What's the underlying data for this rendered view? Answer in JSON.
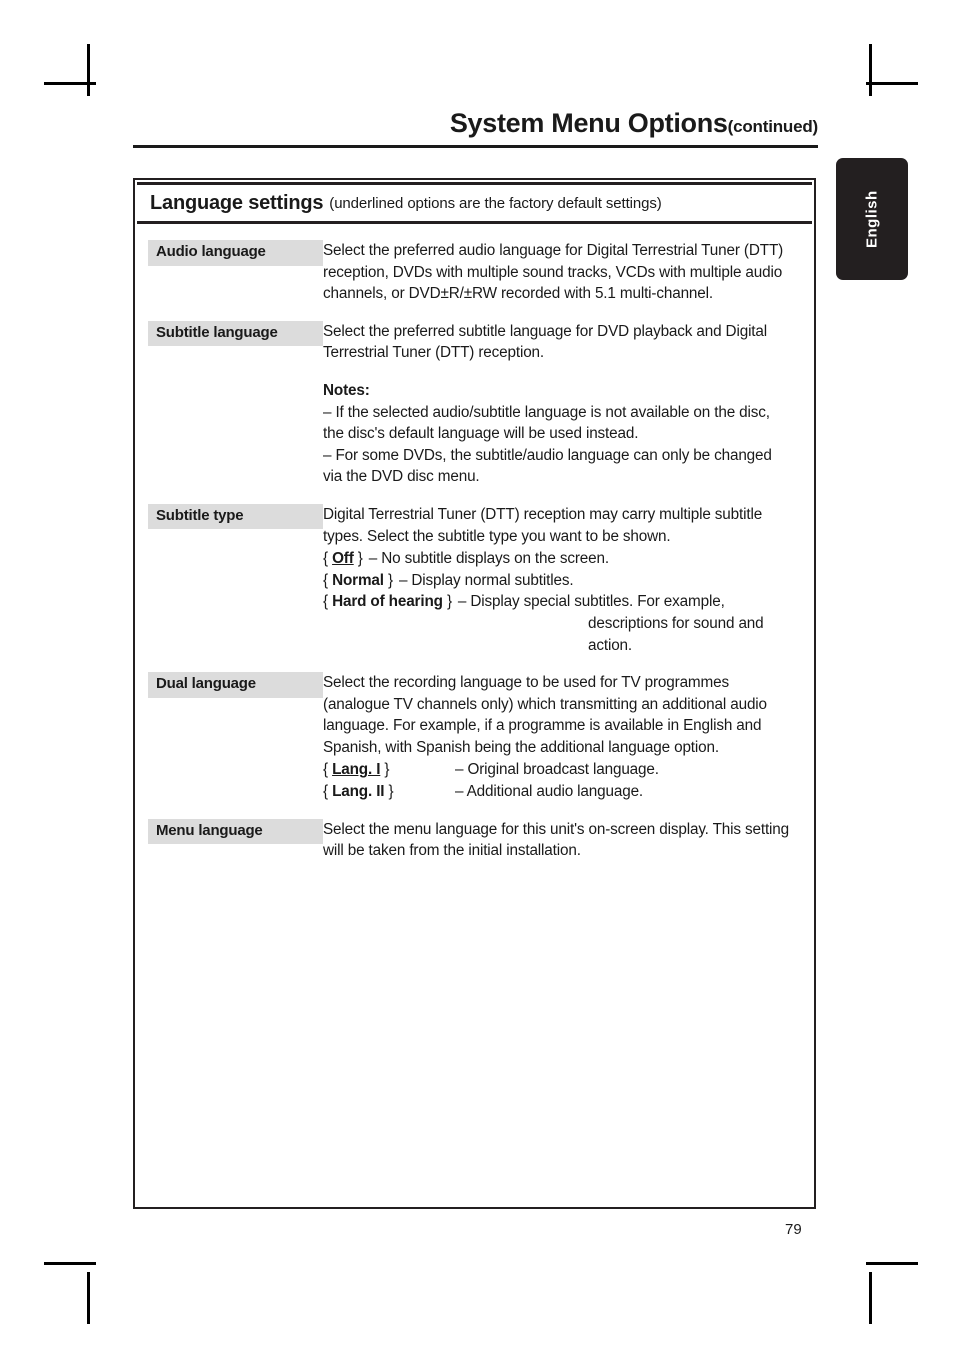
{
  "page": {
    "number": "79",
    "side_tab_label": "English"
  },
  "header": {
    "title": "System Menu Options",
    "continued": "(continued)"
  },
  "section": {
    "title": "Language settings",
    "note": "(underlined options are the factory default settings)"
  },
  "entries": [
    {
      "label": "Audio language",
      "paragraphs": [
        "Select the preferred audio language for Digital Terrestrial Tuner (DTT) reception, DVDs with multiple sound tracks, VCDs with multiple audio channels, or DVD±R/±RW recorded with 5.1 multi-channel."
      ]
    },
    {
      "label": "Subtitle language",
      "paragraphs": [
        "Select the preferred subtitle language for DVD playback and Digital Terrestrial Tuner (DTT) reception."
      ],
      "notes_heading": "Notes:",
      "notes": [
        "–  If the selected audio/subtitle language is not available on the disc, the disc's default language will be used instead.",
        "–  For some DVDs, the subtitle/audio language can only be changed via the DVD disc menu."
      ]
    },
    {
      "label": "Subtitle type",
      "paragraphs": [
        "Digital Terrestrial Tuner (DTT) reception may carry multiple subtitle types.  Select the subtitle type you want to be shown."
      ],
      "options": [
        {
          "open": "{ ",
          "value": "Off",
          "underlined": true,
          "close": " }",
          "desc": "– No subtitle displays on the screen."
        },
        {
          "open": "{ ",
          "value": "Normal",
          "underlined": false,
          "close": " }",
          "desc": "– Display normal subtitles."
        },
        {
          "open": "{ ",
          "value": "Hard of hearing",
          "underlined": false,
          "close": " }",
          "desc": "– Display special subtitles.  For example,",
          "continuation": "descriptions for sound and action."
        }
      ]
    },
    {
      "label": "Dual language",
      "paragraphs": [
        "Select the recording language to be used for TV programmes (analogue TV channels only) which transmitting an additional audio language. For example, if a programme is available in English and Spanish, with Spanish being the additional language option."
      ],
      "options": [
        {
          "open": "{ ",
          "value": "Lang. I",
          "underlined": true,
          "close": " }",
          "desc": "– Original broadcast language."
        },
        {
          "open": "{ ",
          "value": "Lang. II",
          "underlined": false,
          "close": " }",
          "desc": "– Additional audio language."
        }
      ]
    },
    {
      "label": "Menu language",
      "paragraphs": [
        "Select the menu language for this unit's on-screen display.  This setting will be taken from the initial installation."
      ]
    }
  ],
  "colors": {
    "label_background": "#dcdcdc",
    "tab_background": "#231f20",
    "ink": "#1a1a1a"
  }
}
